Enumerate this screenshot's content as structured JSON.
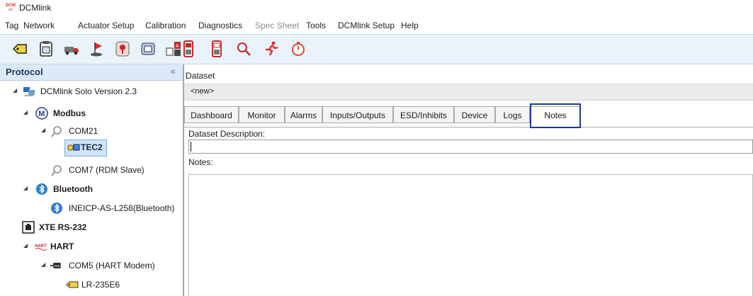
{
  "window": {
    "logo_text": "DCM",
    "title": "DCMlink"
  },
  "menu": [
    {
      "label": "Tag",
      "enabled": true
    },
    {
      "label": "Network",
      "enabled": true
    },
    {
      "label": "Actuator Setup",
      "enabled": true
    },
    {
      "label": "Calibration",
      "enabled": true
    },
    {
      "label": "Diagnostics",
      "enabled": true
    },
    {
      "label": "Spec Sheet",
      "enabled": false
    },
    {
      "label": "Tools",
      "enabled": true
    },
    {
      "label": "DCMlink Setup",
      "enabled": true
    },
    {
      "label": "Help",
      "enabled": true
    }
  ],
  "toolbar": {
    "icons": [
      "tag-icon",
      "clipboard-icon",
      "truck-icon",
      "flag-icon",
      "map-pin-icon",
      "device-icon",
      "red-meter-icon",
      "red-meter-outline-icon",
      "magnifier-icon",
      "running-man-icon",
      "stopwatch-icon"
    ]
  },
  "protocol": {
    "header": "Protocol",
    "collapse_glyph": "«",
    "tree": [
      {
        "label": "DCMlink Solo Version 2.3",
        "icon": "network-computer-icon"
      },
      {
        "label": "Modbus",
        "icon": "modbus-m-icon"
      },
      {
        "label": "COM21",
        "icon": "serial-port-icon"
      },
      {
        "label": "TEC2",
        "icon": "tec-device-icon"
      },
      {
        "label": "COM7 (RDM Slave)",
        "icon": "serial-port-icon"
      },
      {
        "label": "Bluetooth",
        "icon": "bluetooth-icon"
      },
      {
        "label": "INEICP-AS-L258(Bluetooth)",
        "icon": "bluetooth-icon"
      },
      {
        "label": "XTE RS-232",
        "icon": "rs232-icon"
      },
      {
        "label": "HART",
        "icon": "hart-icon",
        "icon_text": "HART"
      },
      {
        "label": "COM5 (HART Modem)",
        "icon": "hart-modem-icon",
        "icon_text": "HART"
      },
      {
        "label": "LR-235E6",
        "icon": "tag-icon"
      }
    ]
  },
  "dataset": {
    "label": "Dataset",
    "current": "<new>"
  },
  "tabs": [
    "Dashboard",
    "Monitor",
    "Alarms",
    "Inputs/Outputs",
    "ESD/Inhibits",
    "Device",
    "Logs",
    "Notes"
  ],
  "active_tab": "Notes",
  "notes_panel": {
    "description_label": "Dataset Description:",
    "description_value": "",
    "notes_label": "Notes:",
    "notes_value": ""
  }
}
